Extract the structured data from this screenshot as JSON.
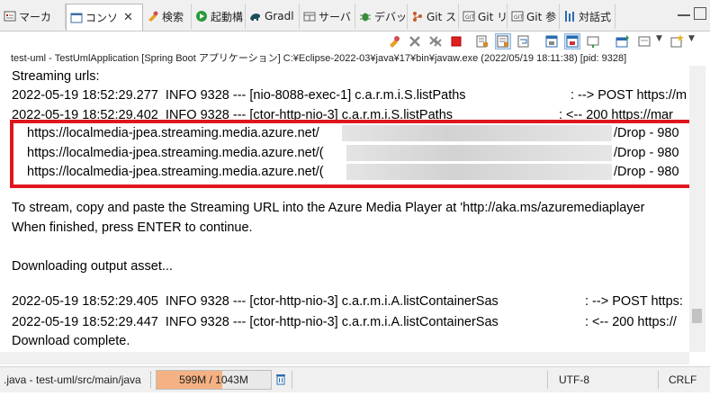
{
  "tabs": [
    {
      "label": "マーカ",
      "icon": "markers-icon"
    },
    {
      "label": "コンソ",
      "icon": "console-icon",
      "active": true
    },
    {
      "label": "検索",
      "icon": "search-icon"
    },
    {
      "label": "起動構",
      "icon": "launch-config-icon"
    },
    {
      "label": "Gradl",
      "icon": "gradle-icon"
    },
    {
      "label": "サーバ",
      "icon": "servers-icon"
    },
    {
      "label": "デバッ",
      "icon": "debug-icon"
    },
    {
      "label": "Git ス",
      "icon": "git-staging-icon"
    },
    {
      "label": "Git リ",
      "icon": "git-repo-icon"
    },
    {
      "label": "Git 参",
      "icon": "git-reflog-icon"
    },
    {
      "label": "対話式",
      "icon": "interactive-icon"
    }
  ],
  "process_line": "test-uml - TestUmlApplication [Spring Boot アプリケーション] C:¥Eclipse-2022-03¥java¥17¥bin¥javaw.exe  (2022/05/19 18:11:38) [pid: 9328]",
  "console": {
    "streaming_header": "Streaming urls:",
    "log1_left": "2022-05-19 18:52:29.277  INFO 9328 --- [nio-8088-exec-1] c.a.r.m.i.S.listPaths",
    "log1_right": ": --> POST https://m",
    "log2_left": "2022-05-19 18:52:29.402  INFO 9328 --- [ctor-http-nio-3] c.a.r.m.i.S.listPaths",
    "log2_right": ": <-- 200 https://mar",
    "urls": [
      {
        "prefix": "https://localmedia-jpea.streaming.media.azure.net/",
        "suffix": "/Drop - 980"
      },
      {
        "prefix": "https://localmedia-jpea.streaming.media.azure.net/(",
        "suffix": "/Drop - 980"
      },
      {
        "prefix": "https://localmedia-jpea.streaming.media.azure.net/(",
        "suffix": "/Drop - 980"
      }
    ],
    "instruction1": "To stream, copy and paste the Streaming URL into the Azure Media Player at 'http://aka.ms/azuremediaplayer",
    "instruction2": "When finished, press ENTER to continue.",
    "downloading": "Downloading output asset...",
    "log3_left": "2022-05-19 18:52:29.405  INFO 9328 --- [ctor-http-nio-3] c.a.r.m.i.A.listContainerSas",
    "log3_right": ": --> POST https:",
    "log4_left": "2022-05-19 18:52:29.447  INFO 9328 --- [ctor-http-nio-3] c.a.r.m.i.A.listContainerSas",
    "log4_right": ": <-- 200 https://",
    "complete": "Download complete."
  },
  "status": {
    "path": ".java - test-uml/src/main/java",
    "heap": "599M / 1043M",
    "heap_fraction": 0.574,
    "encoding": "UTF-8",
    "line_delimiter": "CRLF"
  },
  "colors": {
    "highlight": "#e0161e",
    "heap_fill": "#f4b183"
  }
}
